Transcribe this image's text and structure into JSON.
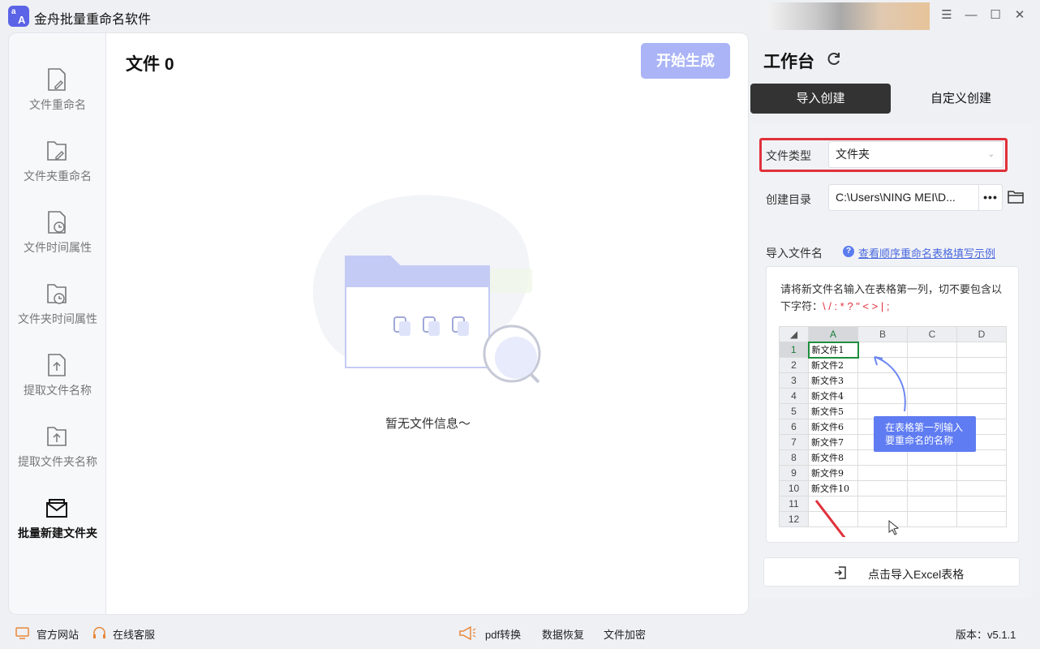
{
  "app": {
    "logo_text": "a A",
    "title": "金舟批量重命名软件"
  },
  "window_controls": [
    "menu",
    "minimize",
    "maximize",
    "close"
  ],
  "sidebar": {
    "items": [
      {
        "label": "文件重命名",
        "icon": "file-edit-icon",
        "active": false
      },
      {
        "label": "文件夹重命名",
        "icon": "folder-edit-icon",
        "active": false
      },
      {
        "label": "文件时间属性",
        "icon": "file-clock-icon",
        "active": false
      },
      {
        "label": "文件夹时间属性",
        "icon": "folder-clock-icon",
        "active": false
      },
      {
        "label": "提取文件名称",
        "icon": "file-upload-icon",
        "active": false
      },
      {
        "label": "提取文件夹名称",
        "icon": "folder-upload-icon",
        "active": false
      },
      {
        "label": "批量新建文件夹",
        "icon": "new-folder-icon",
        "active": true
      }
    ]
  },
  "main": {
    "file_count_label": "文件 0",
    "start_button": "开始生成",
    "empty_text": "暂无文件信息～"
  },
  "workbench": {
    "title": "工作台",
    "tabs": [
      {
        "label": "导入创建",
        "active": true
      },
      {
        "label": "自定义创建",
        "active": false
      }
    ],
    "file_type_label": "文件类型",
    "file_type_value": "文件夹",
    "directory_label": "创建目录",
    "directory_value": "C:\\Users\\NING MEI\\D...",
    "browse_button": "•••",
    "import_names_label": "导入文件名",
    "help_link": "查看顺序重命名表格填写示例",
    "sample": {
      "tip": "请将新文件名输入在表格第一列，切不要包含以下字符：",
      "forbidden_chars": "\\ / : * ? \" < > | ;",
      "columns": [
        "A",
        "B",
        "C",
        "D"
      ],
      "rows": [
        {
          "num": "1",
          "a": "新文件1"
        },
        {
          "num": "2",
          "a": "新文件2"
        },
        {
          "num": "3",
          "a": "新文件3"
        },
        {
          "num": "4",
          "a": "新文件4"
        },
        {
          "num": "5",
          "a": "新文件5"
        },
        {
          "num": "6",
          "a": "新文件6"
        },
        {
          "num": "7",
          "a": "新文件7"
        },
        {
          "num": "8",
          "a": "新文件8"
        },
        {
          "num": "9",
          "a": "新文件9"
        },
        {
          "num": "10",
          "a": "新文件10"
        },
        {
          "num": "11",
          "a": ""
        },
        {
          "num": "12",
          "a": ""
        }
      ],
      "callout": "在表格第一列输入\n要重命名的名称"
    },
    "import_button": "点击导入Excel表格"
  },
  "statusbar": {
    "website": "官方网站",
    "support": "在线客服",
    "pdf": "pdf转换",
    "recovery": "数据恢复",
    "encrypt": "文件加密",
    "version": "版本：v5.1.1"
  },
  "colors": {
    "accent": "#5b63e6",
    "start_button_disabled": "#aab4f6",
    "highlight_red": "#e0313b",
    "tab_active_bg": "#333333",
    "link": "#4a68e0"
  }
}
